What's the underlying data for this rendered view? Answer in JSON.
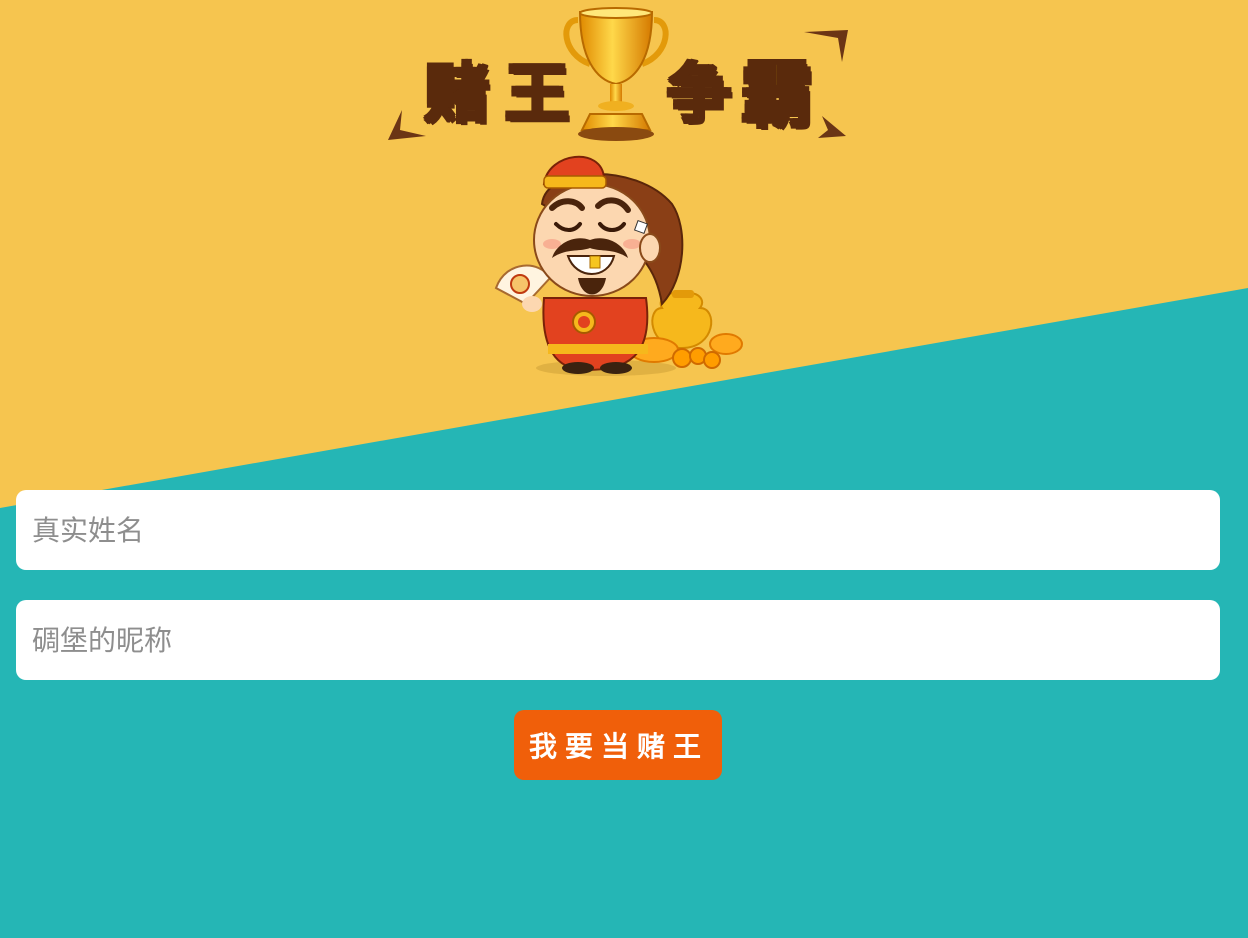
{
  "title": {
    "chars": [
      "赌",
      "王",
      "争",
      "霸"
    ]
  },
  "form": {
    "name_placeholder": "真实姓名",
    "nickname_placeholder": "碉堡的昵称",
    "submit_label": "我要当赌王"
  },
  "colors": {
    "top_background": "#f6c54f",
    "bottom_background": "#25b6b5",
    "button": "#f05f0a",
    "title_fill": "#ffe400",
    "title_outline": "#5a2a0c"
  },
  "icons": [
    "trophy-icon",
    "god-of-wealth-mascot",
    "gold-ingot-icon",
    "money-bag-icon"
  ]
}
